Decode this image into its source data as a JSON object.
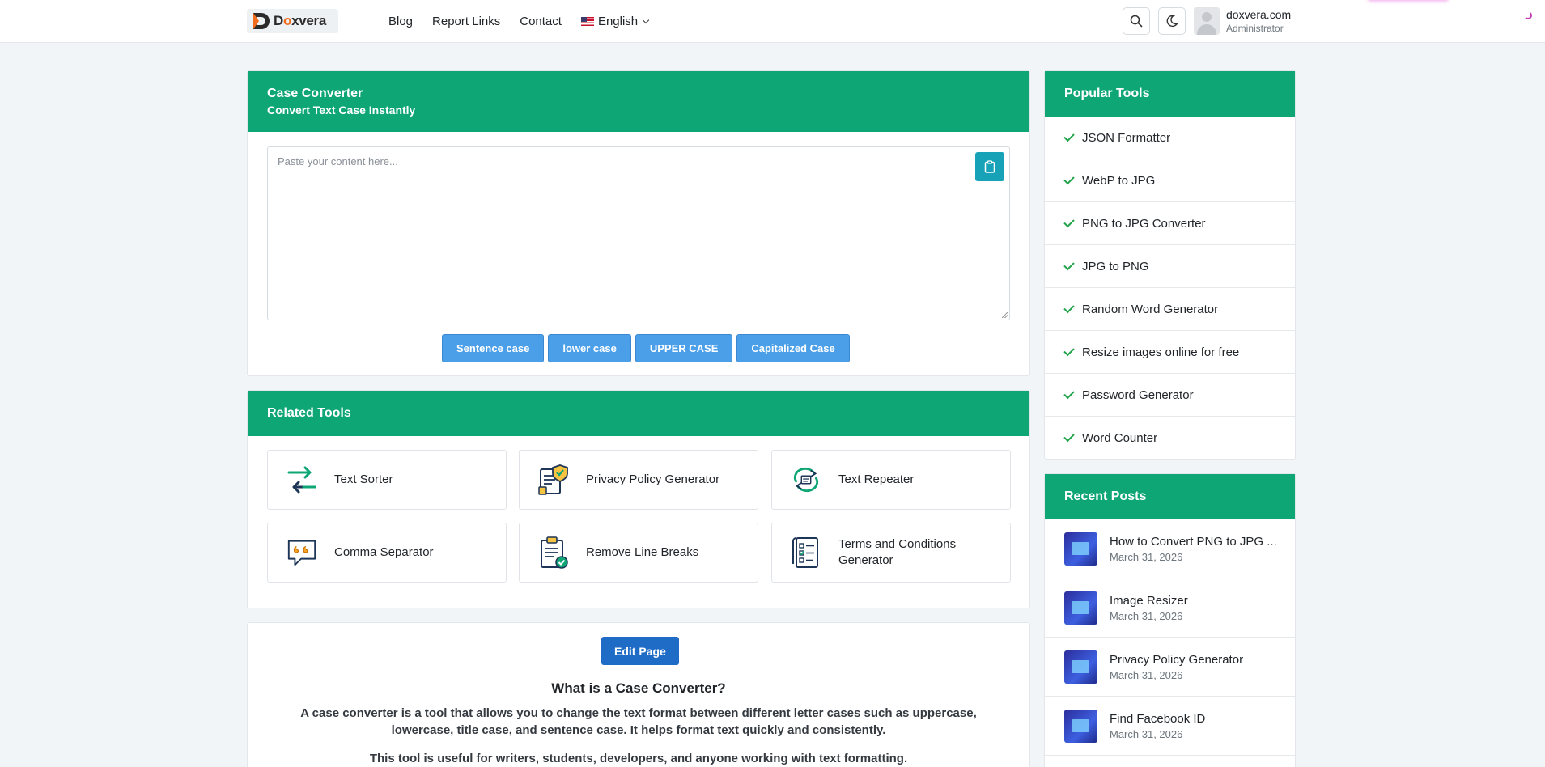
{
  "header": {
    "logo": {
      "text_main": "D",
      "text_rest": "xvera",
      "text_o": "o"
    },
    "nav": [
      "Blog",
      "Report Links",
      "Contact"
    ],
    "language": "English",
    "user": {
      "name": "doxvera.com",
      "role": "Administrator"
    }
  },
  "converter": {
    "title": "Case Converter",
    "subtitle": "Convert Text Case Instantly",
    "placeholder": "Paste your content here...",
    "buttons": [
      "Sentence case",
      "lower case",
      "UPPER CASE",
      "Capitalized Case"
    ]
  },
  "related": {
    "title": "Related Tools",
    "tools": [
      "Text Sorter",
      "Privacy Policy Generator",
      "Text Repeater",
      "Comma Separator",
      "Remove Line Breaks",
      "Terms and Conditions Generator"
    ]
  },
  "content": {
    "edit_label": "Edit Page",
    "heading": "What is a Case Converter?",
    "paragraph1": "A case converter is a tool that allows you to change the text format between different letter cases such as uppercase, lowercase, title case, and sentence case. It helps format text quickly and consistently.",
    "paragraph2": "This tool is useful for writers, students, developers, and anyone working with text formatting."
  },
  "popular": {
    "title": "Popular Tools",
    "items": [
      "JSON Formatter",
      "WebP to JPG",
      "PNG to JPG Converter",
      "JPG to PNG",
      "Random Word Generator",
      "Resize images online for free",
      "Password Generator",
      "Word Counter"
    ]
  },
  "recent": {
    "title": "Recent Posts",
    "posts": [
      {
        "title": "How to Convert PNG to JPG ...",
        "date": "March 31, 2026"
      },
      {
        "title": "Image Resizer",
        "date": "March 31, 2026"
      },
      {
        "title": "Privacy Policy Generator",
        "date": "March 31, 2026"
      },
      {
        "title": "Find Facebook ID",
        "date": "March 31, 2026"
      }
    ]
  },
  "colors": {
    "accent_green": "#0fa675",
    "button_blue": "#4a9fe8",
    "edit_blue": "#1f6cc7",
    "check_green": "#20a34a"
  }
}
